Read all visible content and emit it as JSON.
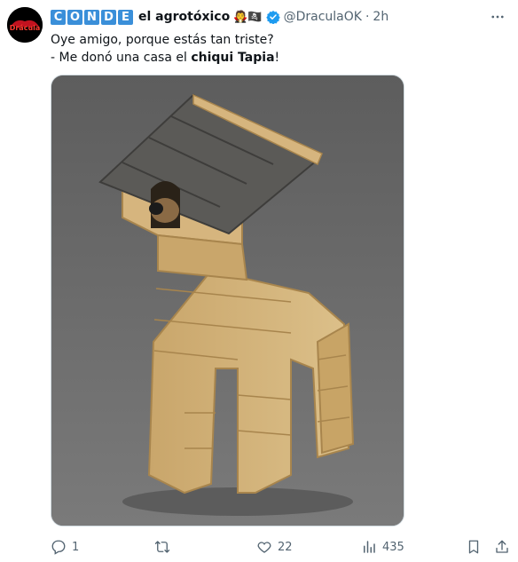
{
  "author": {
    "badge_letters": [
      "C",
      "O",
      "N",
      "D",
      "E"
    ],
    "display_name": "el agrotóxico",
    "emojis": "🧛🏴‍☠️",
    "handle": "@DraculaOK",
    "separator": "·",
    "time": "2h",
    "avatar_text": "Drácula"
  },
  "tweet": {
    "line1": "Oye amigo, porque estás tan triste?",
    "line2_prefix": "- Me donó una casa el ",
    "line2_bold": "chiqui Tapia",
    "line2_suffix": "!"
  },
  "media": {
    "description_icon": "dog-shaped-wooden-doghouse-image"
  },
  "actions": {
    "replies": "1",
    "retweets": "",
    "likes": "22",
    "views": "435"
  },
  "colors": {
    "accent": "#1d9bf0",
    "muted": "#536471",
    "badge": "#3a8fd9"
  }
}
